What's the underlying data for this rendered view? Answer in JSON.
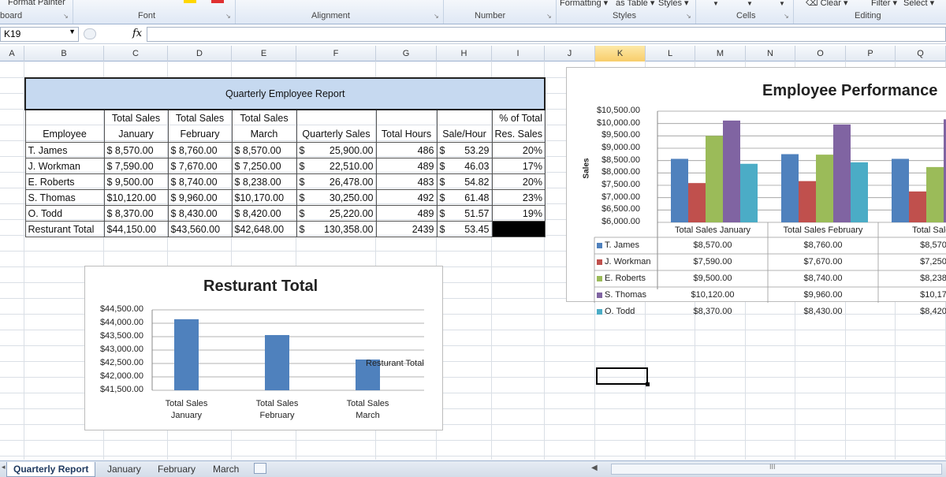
{
  "ribbon": {
    "groups": [
      {
        "name": "clipboard",
        "label": "board",
        "x": 0
      },
      {
        "name": "font",
        "label": "Font",
        "x": 175
      },
      {
        "name": "alignment",
        "label": "Alignment",
        "x": 395
      },
      {
        "name": "number",
        "label": "Number",
        "x": 602
      },
      {
        "name": "styles",
        "label": "Styles",
        "x": 777
      },
      {
        "name": "cells",
        "label": "Cells",
        "x": 934
      },
      {
        "name": "editing",
        "label": "Editing",
        "x": 1084
      }
    ],
    "top_items": {
      "format_painter": "Format Painter",
      "formatting": "Formatting ▾",
      "as_table": "as Table ▾",
      "styles_btn": "Styles ▾",
      "clear": "Clear ▾",
      "filter": "Filter ▾",
      "select": "Select ▾"
    }
  },
  "formula_bar": {
    "name_box": "K19",
    "fx": "fx",
    "formula": ""
  },
  "columns": [
    {
      "label": "A",
      "w": 31
    },
    {
      "label": "B",
      "w": 101
    },
    {
      "label": "C",
      "w": 81
    },
    {
      "label": "D",
      "w": 81
    },
    {
      "label": "E",
      "w": 82
    },
    {
      "label": "F",
      "w": 101
    },
    {
      "label": "G",
      "w": 77
    },
    {
      "label": "H",
      "w": 70
    },
    {
      "label": "I",
      "w": 67
    },
    {
      "label": "J",
      "w": 64
    },
    {
      "label": "K",
      "w": 64
    },
    {
      "label": "L",
      "w": 63
    },
    {
      "label": "M",
      "w": 64
    },
    {
      "label": "N",
      "w": 63
    },
    {
      "label": "O",
      "w": 64
    },
    {
      "label": "P",
      "w": 63
    },
    {
      "label": "Q",
      "w": 64
    }
  ],
  "selected_column": "K",
  "report": {
    "title": "Quarterly Employee Report",
    "headers": [
      [
        "",
        "Employee"
      ],
      [
        "Total Sales",
        "January"
      ],
      [
        "Total Sales",
        "February"
      ],
      [
        "Total Sales",
        "March"
      ],
      [
        "",
        "Quarterly Sales"
      ],
      [
        "",
        "Total Hours"
      ],
      [
        "",
        "Sale/Hour"
      ],
      [
        "% of Total",
        "Res. Sales"
      ]
    ],
    "rows": [
      {
        "name": "T. James",
        "jan": "$ 8,570.00",
        "feb": "$ 8,760.00",
        "mar": "$ 8,570.00",
        "qs": "25,900.00",
        "hours": "486",
        "sph": "53.29",
        "pct": "20%"
      },
      {
        "name": "J. Workman",
        "jan": "$ 7,590.00",
        "feb": "$ 7,670.00",
        "mar": "$ 7,250.00",
        "qs": "22,510.00",
        "hours": "489",
        "sph": "46.03",
        "pct": "17%"
      },
      {
        "name": "E. Roberts",
        "jan": "$ 9,500.00",
        "feb": "$ 8,740.00",
        "mar": "$ 8,238.00",
        "qs": "26,478.00",
        "hours": "483",
        "sph": "54.82",
        "pct": "20%"
      },
      {
        "name": "S. Thomas",
        "jan": "$10,120.00",
        "feb": "$ 9,960.00",
        "mar": "$10,170.00",
        "qs": "30,250.00",
        "hours": "492",
        "sph": "61.48",
        "pct": "23%"
      },
      {
        "name": "O. Todd",
        "jan": "$ 8,370.00",
        "feb": "$ 8,430.00",
        "mar": "$ 8,420.00",
        "qs": "25,220.00",
        "hours": "489",
        "sph": "51.57",
        "pct": "19%"
      }
    ],
    "total": {
      "name": "Resturant Total",
      "jan": "$44,150.00",
      "feb": "$43,560.00",
      "mar": "$42,648.00",
      "qs": "130,358.00",
      "hours": "2439",
      "sph": "53.45"
    }
  },
  "chart_data": [
    {
      "type": "bar",
      "title": "Resturant Total",
      "categories": [
        "Total Sales January",
        "Total Sales February",
        "Total Sales March"
      ],
      "series": [
        {
          "name": "Resturant Total",
          "values": [
            44150,
            43560,
            42648
          ],
          "color": "#4f81bd"
        }
      ],
      "ylim": [
        41500,
        44500
      ],
      "yticks": [
        "$44,500.00",
        "$44,000.00",
        "$43,500.00",
        "$43,000.00",
        "$42,500.00",
        "$42,000.00",
        "$41,500.00"
      ],
      "legend": "right"
    },
    {
      "type": "bar",
      "title": "Employee Performance",
      "ylabel": "Sales",
      "categories": [
        "Total Sales January",
        "Total Sales February",
        "Total Sales"
      ],
      "series": [
        {
          "name": "T. James",
          "values": [
            8570,
            8760,
            8570
          ],
          "color": "#4f81bd",
          "labels": [
            "$8,570.00",
            "$8,760.00",
            "$8,570"
          ]
        },
        {
          "name": "J. Workman",
          "values": [
            7590,
            7670,
            7250
          ],
          "color": "#c0504d",
          "labels": [
            "$7,590.00",
            "$7,670.00",
            "$7,250"
          ]
        },
        {
          "name": "E. Roberts",
          "values": [
            9500,
            8740,
            8238
          ],
          "color": "#9bbb59",
          "labels": [
            "$9,500.00",
            "$8,740.00",
            "$8,238"
          ]
        },
        {
          "name": "S. Thomas",
          "values": [
            10120,
            9960,
            10170
          ],
          "color": "#8064a2",
          "labels": [
            "$10,120.00",
            "$9,960.00",
            "$10,17"
          ]
        },
        {
          "name": "O. Todd",
          "values": [
            8370,
            8430,
            8420
          ],
          "color": "#4bacc6",
          "labels": [
            "$8,370.00",
            "$8,430.00",
            "$8,420"
          ]
        }
      ],
      "ylim": [
        6000,
        10500
      ],
      "yticks": [
        "$10,500.00",
        "$10,000.00",
        "$9,500.00",
        "$9,000.00",
        "$8,500.00",
        "$8,000.00",
        "$7,500.00",
        "$7,000.00",
        "$6,500.00",
        "$6,000.00"
      ],
      "legend": "data-table"
    }
  ],
  "sheet_tabs": [
    "Quarterly Report",
    "January",
    "February",
    "March"
  ],
  "active_tab": "Quarterly Report",
  "scroll_label": "III"
}
